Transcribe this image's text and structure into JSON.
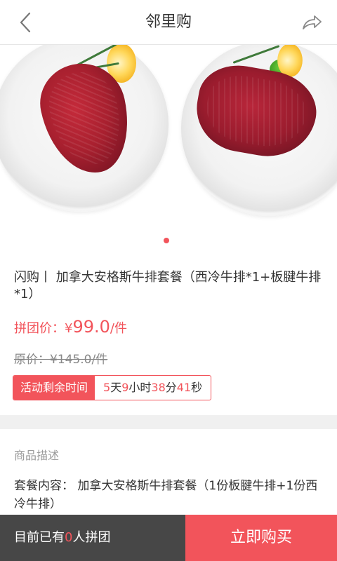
{
  "header": {
    "title": "邻里购",
    "back_icon": "chevron-left-icon",
    "share_icon": "share-arrow-icon"
  },
  "carousel": {
    "total_slides": 1,
    "active_index": 0
  },
  "product": {
    "title": "闪购丨 加拿大安格斯牛排套餐（西冷牛排*1+板腱牛排*1）",
    "group_price_label": "拼团价：",
    "group_price_currency": "¥",
    "group_price_value": "99.0",
    "group_price_unit": "/件",
    "original_price": "原价：¥145.0/件"
  },
  "countdown": {
    "label": "活动剩余时间",
    "days": "5",
    "days_unit": "天",
    "hours": "9",
    "hours_unit": "小时",
    "minutes": "38",
    "minutes_unit": "分",
    "seconds": "41",
    "seconds_unit": "秒"
  },
  "description": {
    "heading": "商品描述",
    "content": "套餐内容： 加拿大安格斯牛排套餐（1份板腱牛排+1份西冷牛排）"
  },
  "bottom_bar": {
    "group_count_prefix": "目前已有",
    "group_count": "0",
    "group_count_suffix": "人拼团",
    "buy_button": "立即购买"
  },
  "colors": {
    "accent": "#f2545b",
    "bottom_left_bg": "#474747"
  }
}
